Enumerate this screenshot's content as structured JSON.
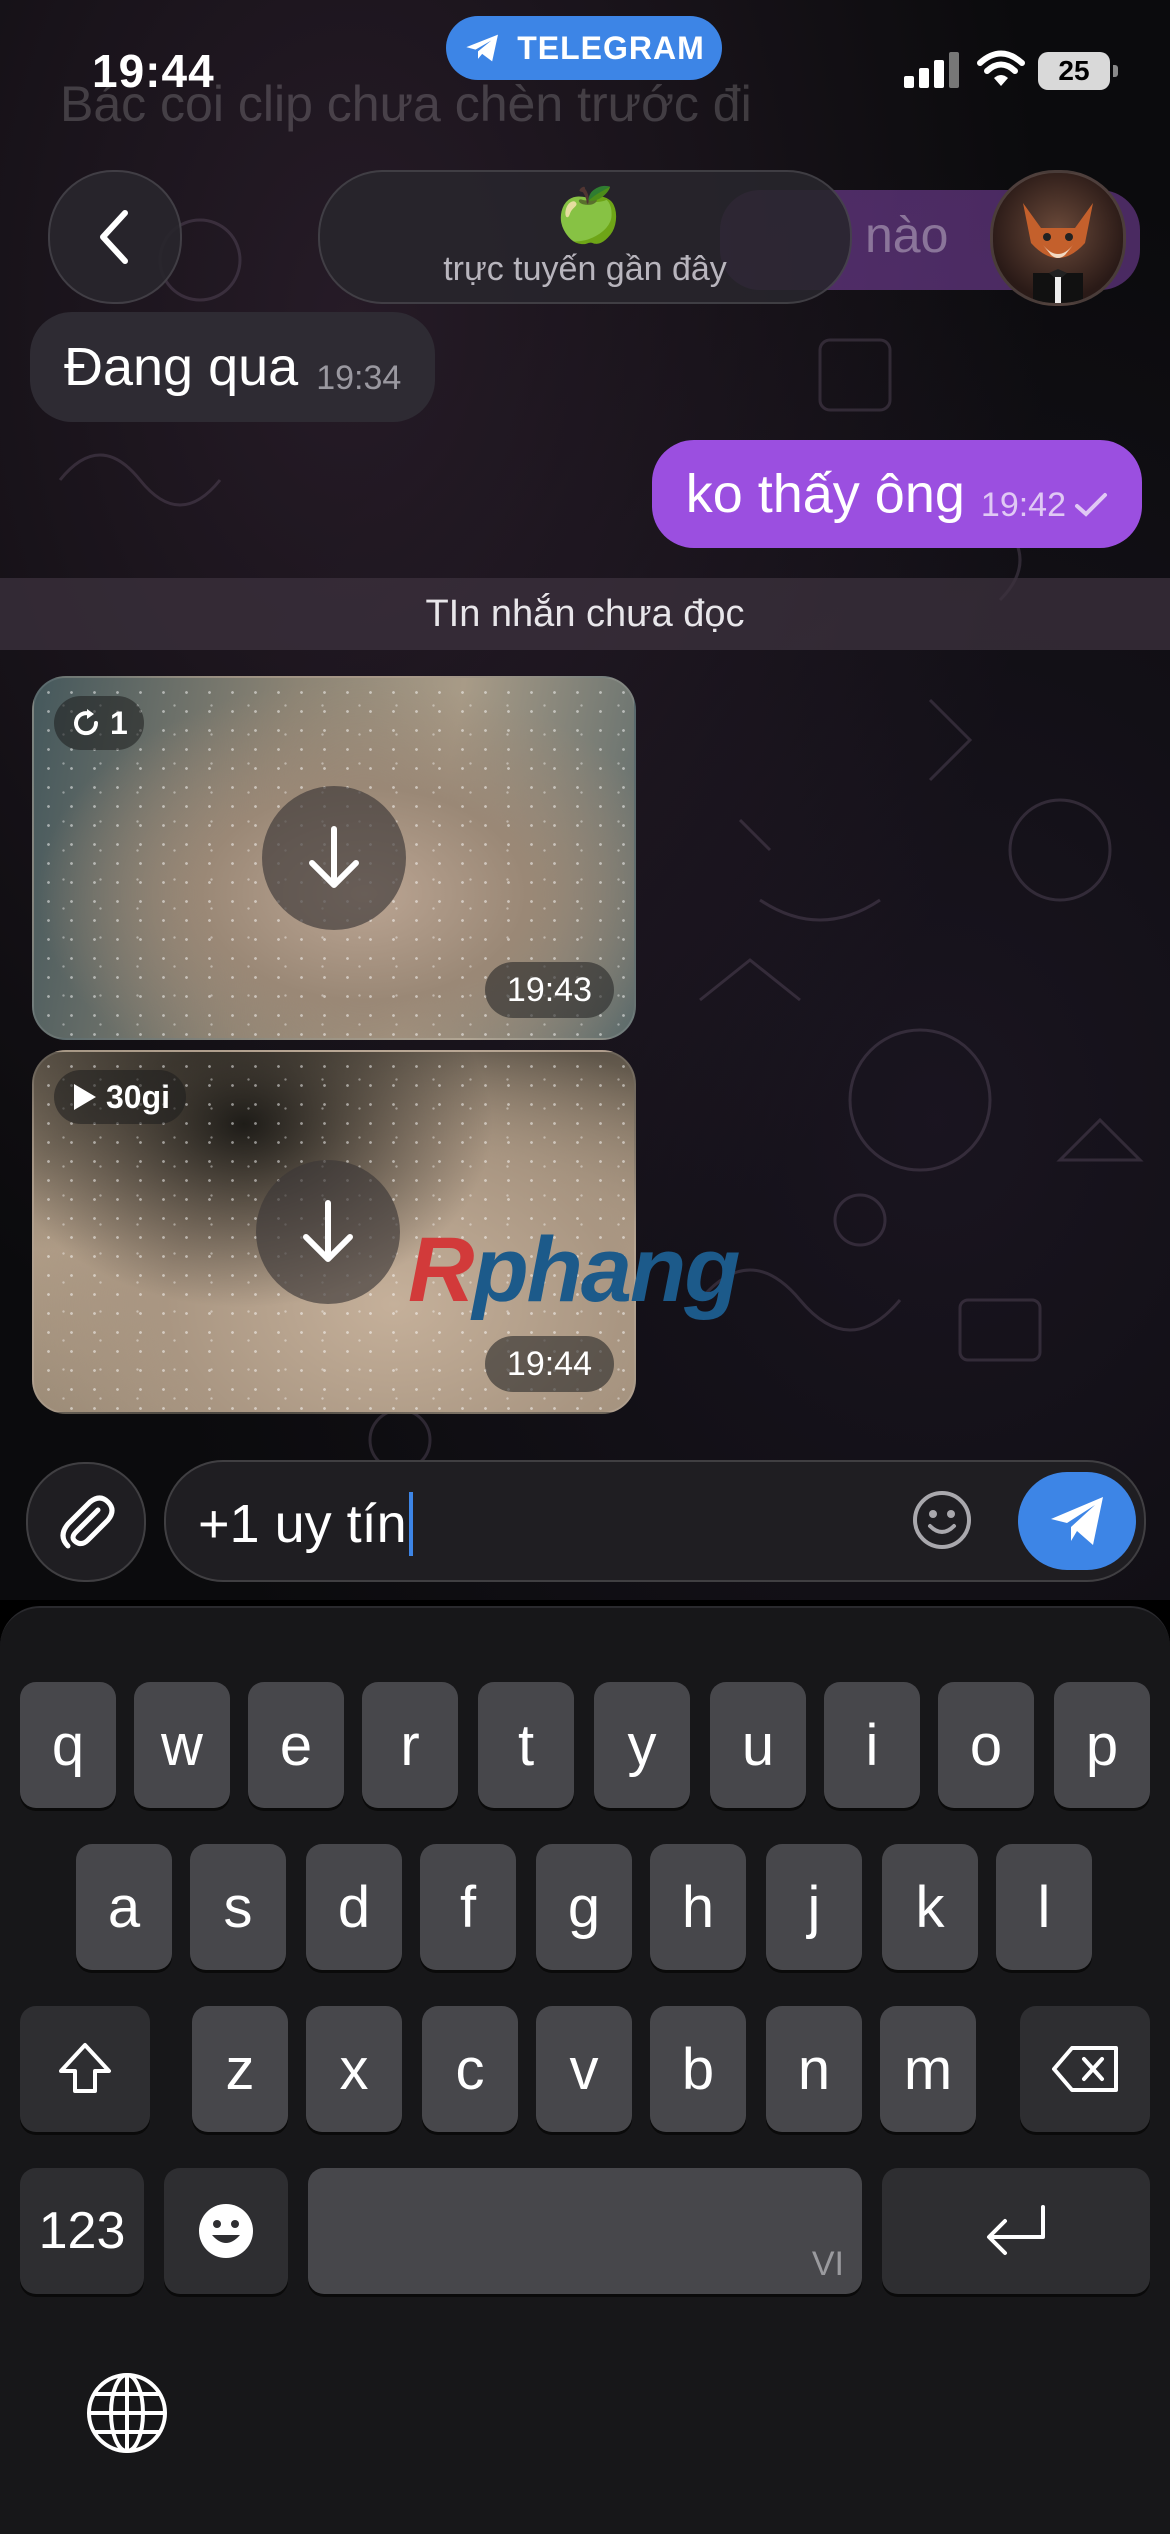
{
  "status_bar": {
    "time": "19:44",
    "app_pill": "TELEGRAM",
    "battery": "25"
  },
  "header": {
    "title_emoji": "🍏",
    "subtitle": "trực tuyến gần đây"
  },
  "background_text": {
    "top_message": "Bác coi clip chưa chèn trước đi",
    "purple_message": "nào"
  },
  "messages": [
    {
      "direction": "in",
      "text": "Đang qua",
      "time": "19:34"
    },
    {
      "direction": "out",
      "text": "ko thấy ông",
      "time": "19:42",
      "status": "sent"
    }
  ],
  "unread_divider": "TIn nhắn chưa đọc",
  "media": [
    {
      "badge": "1",
      "badge_icon": "replay-icon",
      "time": "19:43"
    },
    {
      "badge": "30gi",
      "badge_icon": "play-icon",
      "time": "19:44"
    }
  ],
  "watermark": {
    "first": "R",
    "rest": "phang"
  },
  "composer": {
    "text": "+1 uy tín"
  },
  "keyboard": {
    "row1": [
      "q",
      "w",
      "e",
      "r",
      "t",
      "y",
      "u",
      "i",
      "o",
      "p"
    ],
    "row2": [
      "a",
      "s",
      "d",
      "f",
      "g",
      "h",
      "j",
      "k",
      "l"
    ],
    "row3": [
      "z",
      "x",
      "c",
      "v",
      "b",
      "n",
      "m"
    ],
    "numbers_key": "123",
    "space_hint": "VI"
  },
  "colors": {
    "accent": "#3d85e6",
    "outgoing_bubble": "#9b4fe0",
    "incoming_bubble": "#2e2b33"
  }
}
